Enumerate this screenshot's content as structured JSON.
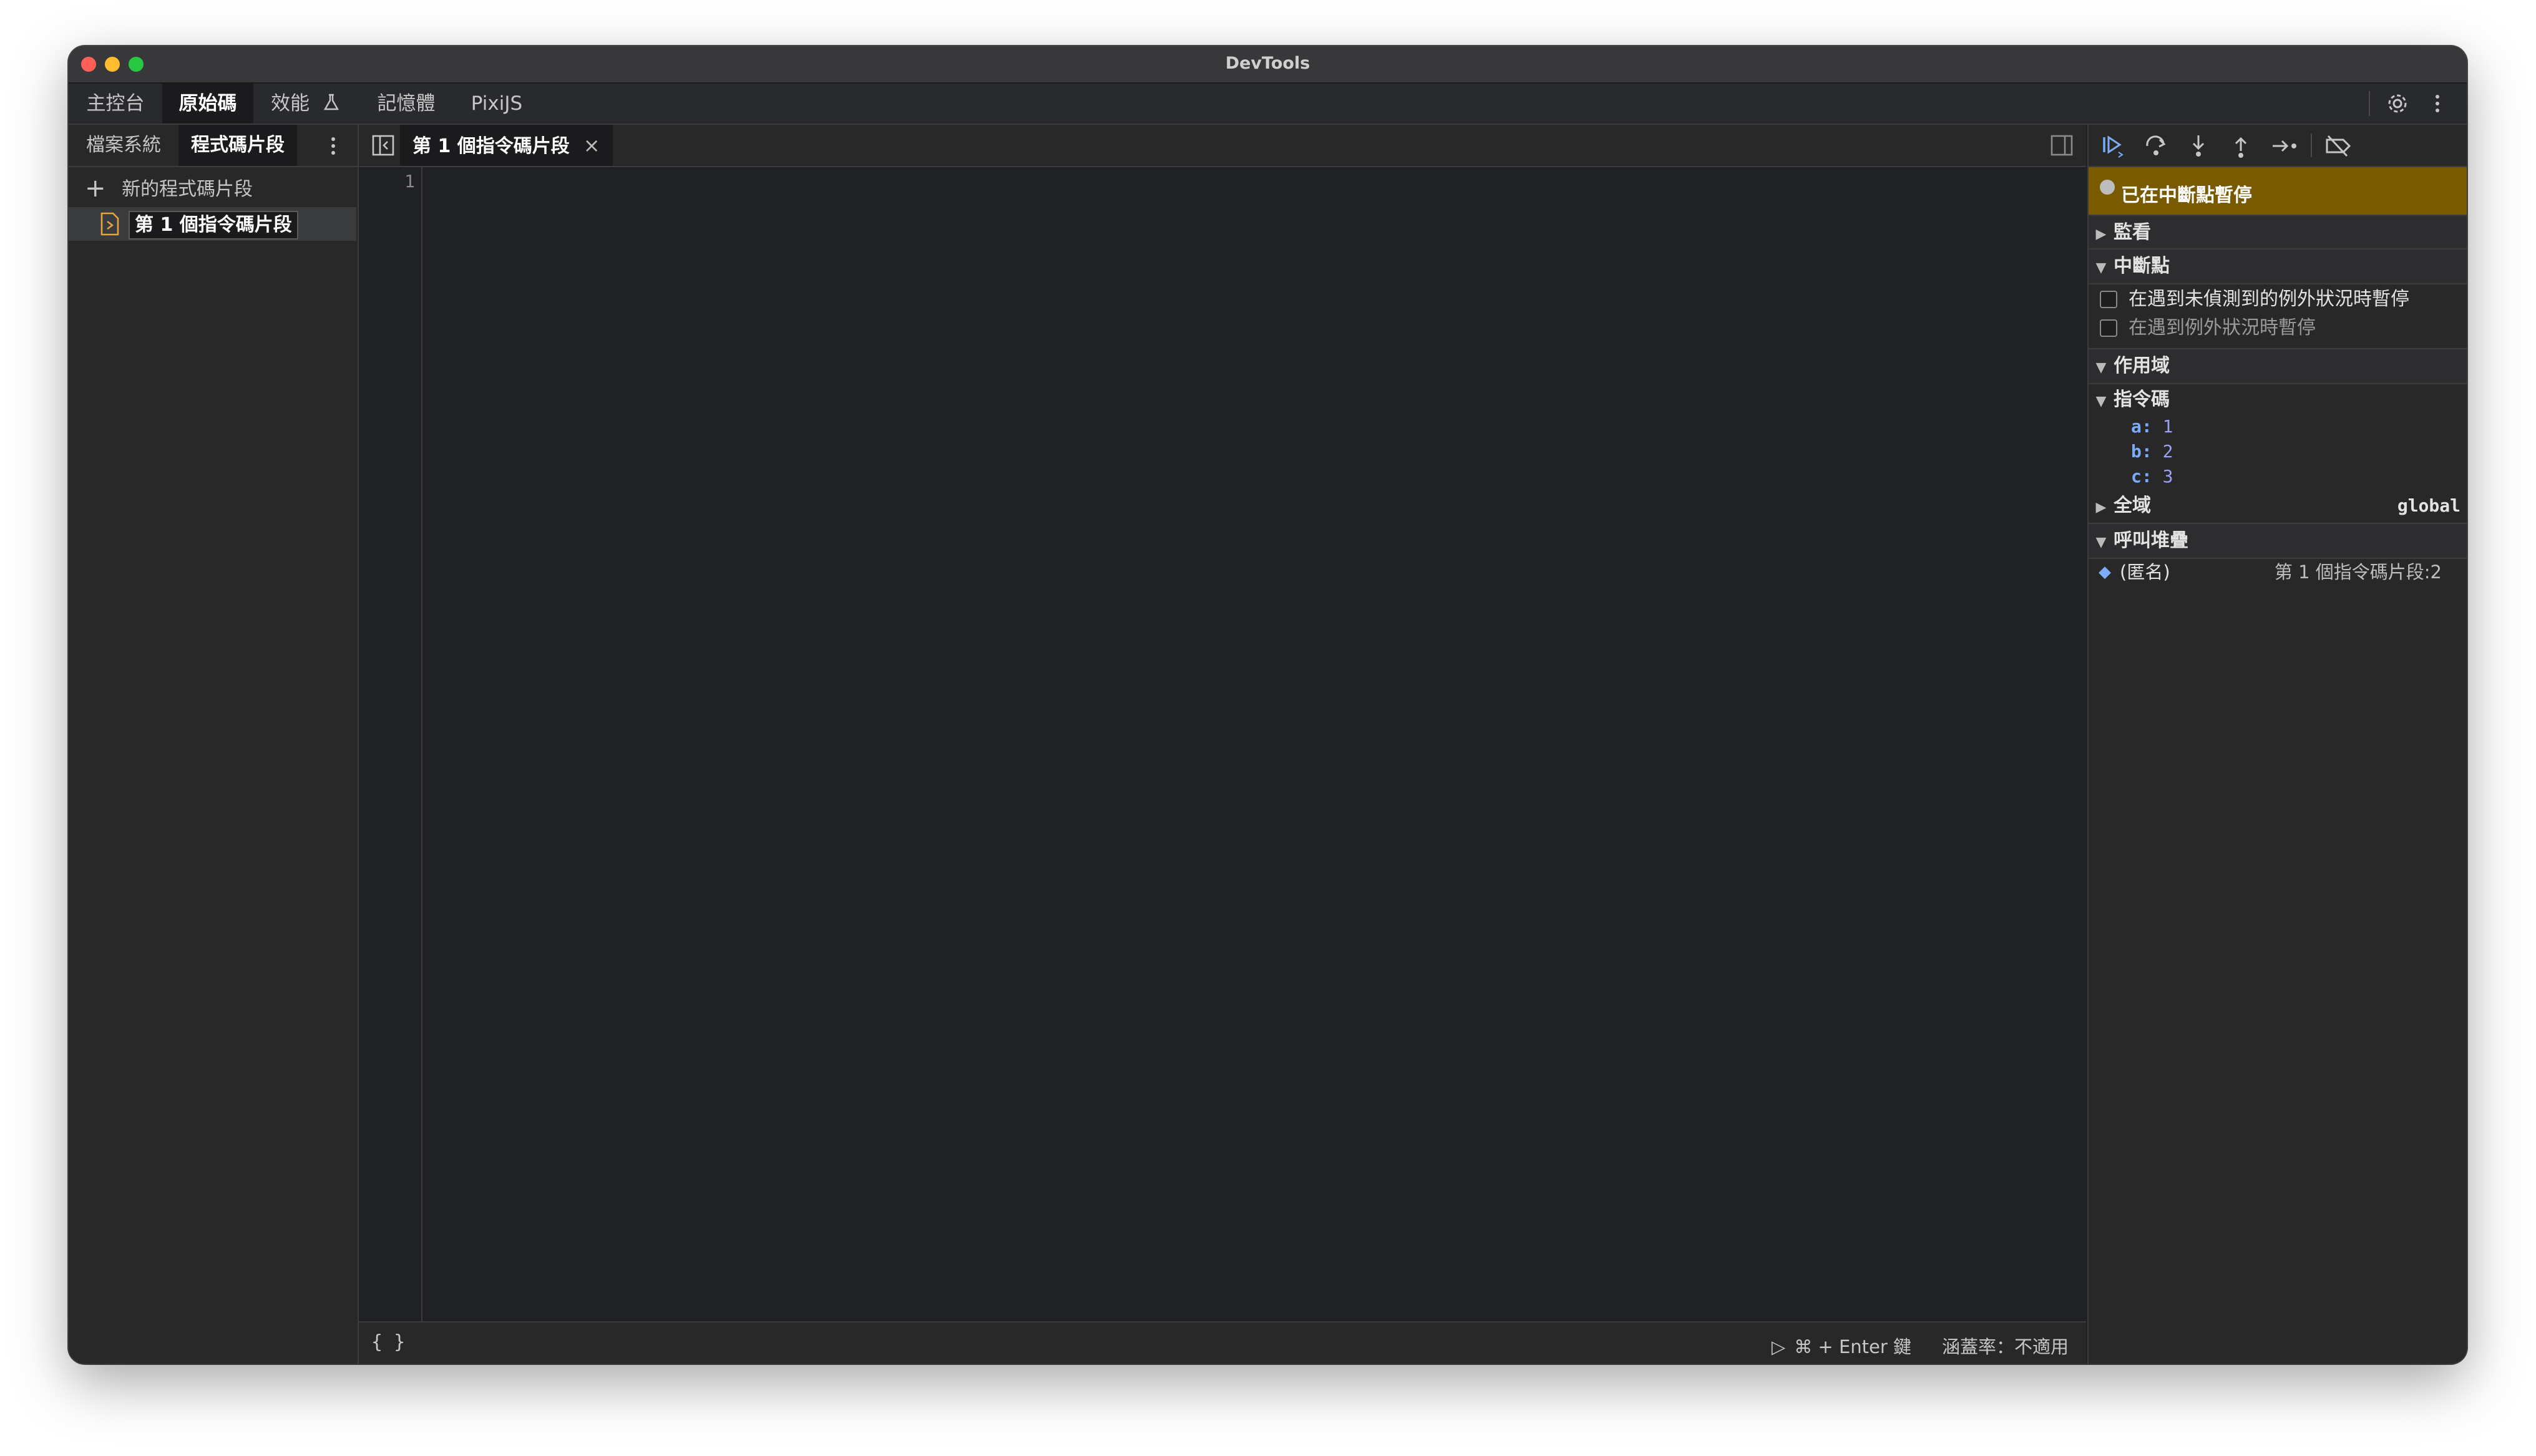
{
  "window": {
    "title": "DevTools"
  },
  "main_tabs": [
    {
      "label": "主控台"
    },
    {
      "label": "原始碼"
    },
    {
      "label": "效能"
    },
    {
      "label": "記憶體"
    },
    {
      "label": "PixiJS"
    }
  ],
  "sidebar": {
    "tabs": [
      {
        "label": "檔案系統"
      },
      {
        "label": "程式碼片段"
      }
    ],
    "new_snippet_label": "新的程式碼片段",
    "snippets": [
      {
        "label": "第 1 個指令碼片段"
      }
    ]
  },
  "editor": {
    "open_tab": "第 1 個指令碼片段",
    "line_numbers": [
      "1"
    ],
    "status": {
      "format_icon": "{ }",
      "run_hint": "⌘ + Enter 鍵",
      "coverage": "涵蓋率：不適用"
    }
  },
  "debugger": {
    "paused_banner": "已在中斷點暫停",
    "sections": {
      "watch": "監看",
      "breakpoints": "中斷點",
      "scope": "作用域",
      "call_stack": "呼叫堆疊"
    },
    "breakpoint_options": [
      {
        "label": "在遇到未偵測到的例外狀況時暫停",
        "checked": false
      },
      {
        "label": "在遇到例外狀況時暫停",
        "checked": false
      }
    ],
    "scope": {
      "local_label": "指令碼",
      "variables": [
        {
          "name": "a",
          "value": "1"
        },
        {
          "name": "b",
          "value": "2"
        },
        {
          "name": "c",
          "value": "3"
        }
      ],
      "global_label": "全域",
      "global_value": "global"
    },
    "call_stack": [
      {
        "name": "(匿名)",
        "location": "第 1 個指令碼片段:2"
      }
    ]
  },
  "colors": {
    "paused_banner": "#7a5a00",
    "accent_blue": "#7cacf8",
    "window_bg": "#202124"
  }
}
